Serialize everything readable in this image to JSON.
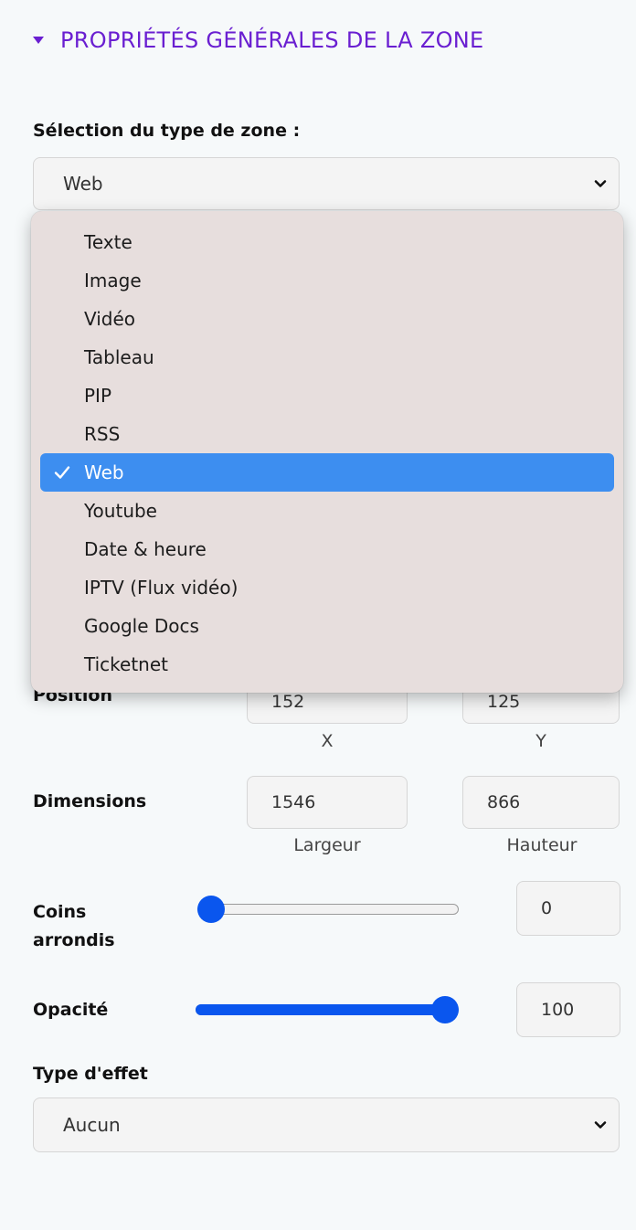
{
  "section": {
    "title": "PROPRIÉTÉS GÉNÉRALES DE LA ZONE"
  },
  "zone_type": {
    "label": "Sélection du type de zone :",
    "selected": "Web",
    "options": [
      "Texte",
      "Image",
      "Vidéo",
      "Tableau",
      "PIP",
      "RSS",
      "Web",
      "Youtube",
      "Date & heure",
      "IPTV (Flux vidéo)",
      "Google Docs",
      "Ticketnet"
    ]
  },
  "position": {
    "label": "Position",
    "x": "152",
    "y": "125",
    "x_caption": "X",
    "y_caption": "Y"
  },
  "dimensions": {
    "label": "Dimensions",
    "width": "1546",
    "height": "866",
    "width_caption": "Largeur",
    "height_caption": "Hauteur"
  },
  "corners": {
    "label_line1": "Coins",
    "label_line2": "arrondis",
    "value": "0",
    "slider_fraction": 0
  },
  "opacity": {
    "label": "Opacité",
    "value": "100",
    "slider_fraction": 1
  },
  "effect": {
    "label": "Type d'effet",
    "selected": "Aucun"
  },
  "colors": {
    "accent_purple": "#6a1fd1",
    "slider_blue": "#0a56ee",
    "selection_blue": "#3d8ef0"
  }
}
